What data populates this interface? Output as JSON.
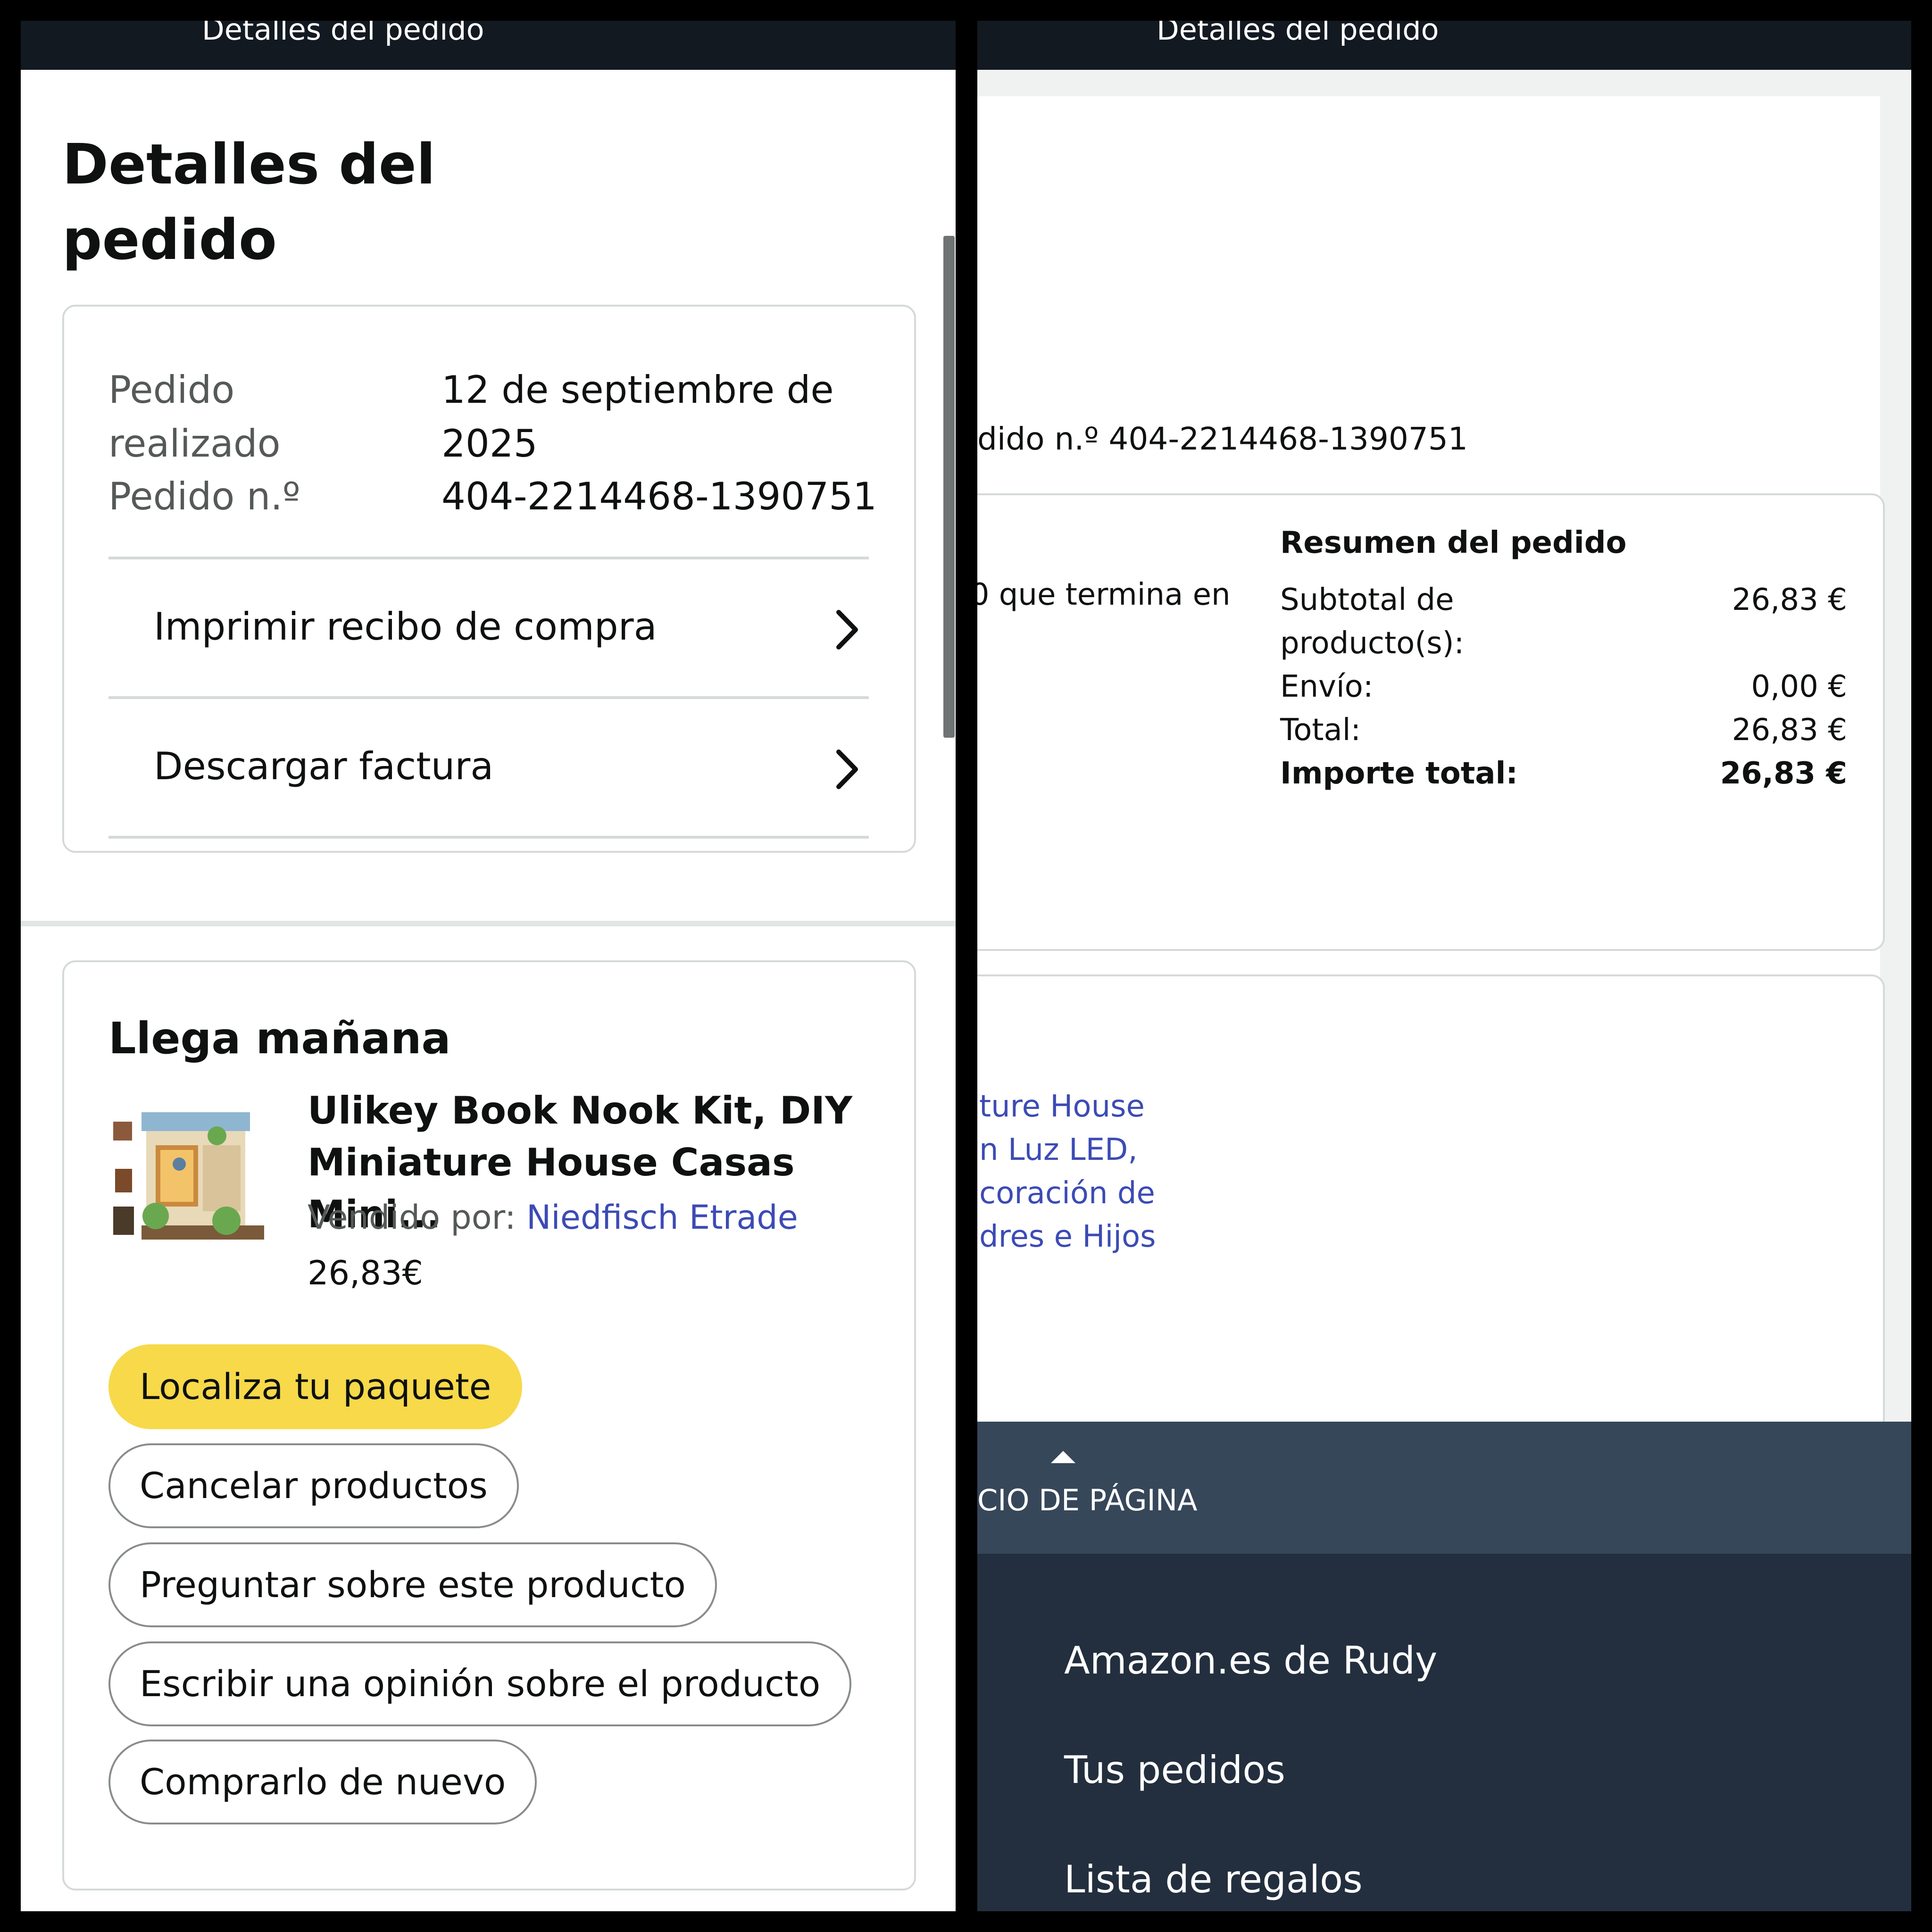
{
  "left": {
    "topbar_title": "Detalles del pedido",
    "page_title": "Detalles del pedido",
    "order_info": {
      "placed_label": "Pedido realizado",
      "placed_value": "12 de septiembre de 2025",
      "number_label": "Pedido n.º",
      "number_value": "404-2214468-1390751"
    },
    "links": [
      {
        "label": "Imprimir recibo de compra"
      },
      {
        "label": "Descargar factura"
      }
    ],
    "delivery": {
      "title": "Llega mañana",
      "product_title": "Ulikey Book Nook Kit, DIY Miniature House Casas Mini...",
      "sold_by_label": "Vendido por:",
      "seller": "Niedfisch Etrade",
      "price": "26,83€",
      "buttons": [
        "Localiza tu paquete",
        "Cancelar productos",
        "Preguntar sobre este producto",
        "Escribir una opinión sobre el producto",
        "Comprarlo de nuevo"
      ]
    }
  },
  "right": {
    "topbar_title": "Detalles del pedido",
    "order_number_text": "dido n.º 404-2214468-1390751",
    "payment_text": "00  que termina en",
    "summary": {
      "title": "Resumen del pedido",
      "subtotal_label": "Subtotal de producto(s):",
      "subtotal_value": "26,83 €",
      "shipping_label": "Envío:",
      "shipping_value": "0,00 €",
      "total_label": "Total:",
      "total_value": "26,83 €",
      "grand_label": "Importe total:",
      "grand_value": "26,83 €"
    },
    "item_link_text": "ture House\nn Luz LED,\ncoración de\ndres e Hijos",
    "back_to_top": "CIO DE PÁGINA",
    "footer_items": [
      "Amazon.es de Rudy",
      "Tus pedidos",
      "Lista de regalos"
    ]
  },
  "colors": {
    "header": "#131921",
    "primary_button": "#f7d94a",
    "link": "#3c4bb5",
    "footer": "#232f3e",
    "back_to_top": "#37475a"
  }
}
